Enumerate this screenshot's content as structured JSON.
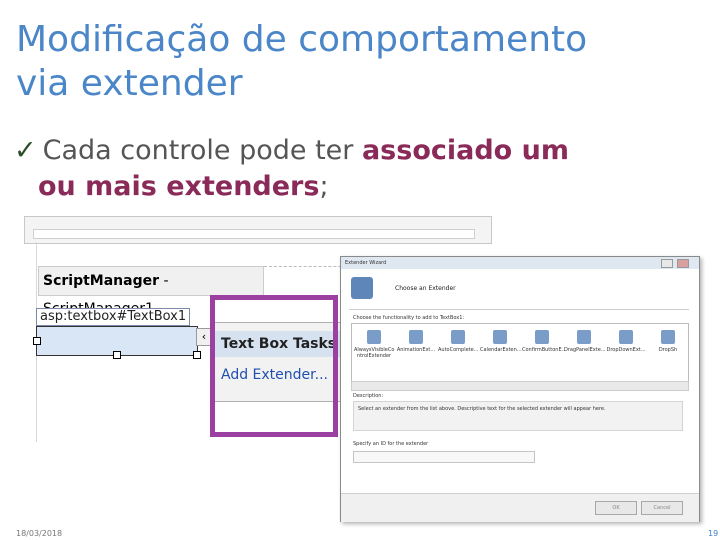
{
  "slide": {
    "title_line1": "Modificação de comportamento",
    "title_line2": "via extender",
    "bullet_prefix": "Cada controle pode ter ",
    "bullet_emph1": "associado um",
    "bullet_emph2": "ou mais extenders",
    "bullet_suffix": ";",
    "date": "18/03/2018",
    "page_number": "19",
    "title_color": "#4a86c8",
    "emphasis_color": "#8a2a58",
    "highlight_color": "#9b3fa0"
  },
  "designer": {
    "scriptmanager_label_bold": "ScriptManager",
    "scriptmanager_label_rest": " - ScriptManager1",
    "textbox_tag": "asp:textbox#TextBox1",
    "smart_tag_glyph": "‹",
    "tasks_title": "Text Box Tasks",
    "tasks_link": "Add Extender..."
  },
  "wizard": {
    "window_title": "Extender Wizard",
    "header": "Choose an Extender",
    "choose_label": "Choose the functionality to add to TextBox1:",
    "items": [
      "AlwaysVisibleCo ntrolExtender",
      "AnimationExt...",
      "AutoComplete...",
      "CalendarExten...",
      "ConfirmButtonE...",
      "DragPanelExte...",
      "DropDownExt...",
      "DropSh"
    ],
    "description_label": "Description:",
    "description_text": "Select an extender from the list above. Descriptive text for the selected extender will appear here.",
    "id_label": "Specify an ID for the extender",
    "ok_label": "OK",
    "cancel_label": "Cancel"
  }
}
